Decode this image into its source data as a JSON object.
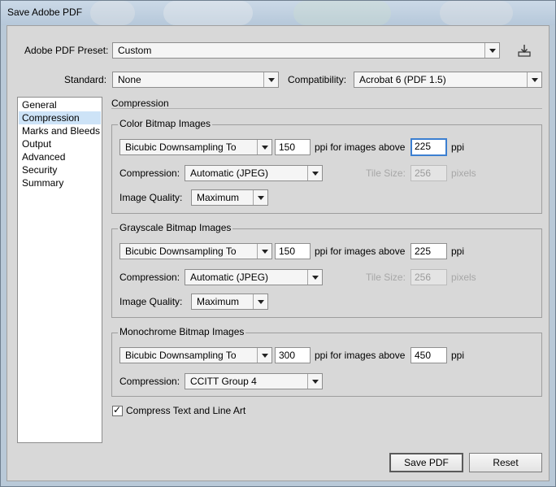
{
  "window": {
    "title": "Save Adobe PDF"
  },
  "preset": {
    "label": "Adobe PDF Preset:",
    "value": "Custom",
    "save_icon": "save-preset-icon"
  },
  "standard": {
    "label": "Standard:",
    "value": "None"
  },
  "compatibility": {
    "label": "Compatibility:",
    "value": "Acrobat 6 (PDF 1.5)"
  },
  "sidebar": {
    "items": [
      {
        "label": "General"
      },
      {
        "label": "Compression",
        "selected": true
      },
      {
        "label": "Marks and Bleeds"
      },
      {
        "label": "Output"
      },
      {
        "label": "Advanced"
      },
      {
        "label": "Security"
      },
      {
        "label": "Summary"
      }
    ]
  },
  "section": {
    "title": "Compression"
  },
  "color_group": {
    "title": "Color Bitmap Images",
    "downsampling": "Bicubic Downsampling To",
    "ppi": "150",
    "above_label": "ppi for images above",
    "above_ppi": "225",
    "ppi_unit": "ppi",
    "compression_label": "Compression:",
    "compression": "Automatic (JPEG)",
    "tile_label": "Tile Size:",
    "tile": "256",
    "tile_unit": "pixels",
    "quality_label": "Image Quality:",
    "quality": "Maximum"
  },
  "gray_group": {
    "title": "Grayscale Bitmap Images",
    "downsampling": "Bicubic Downsampling To",
    "ppi": "150",
    "above_label": "ppi for images above",
    "above_ppi": "225",
    "ppi_unit": "ppi",
    "compression_label": "Compression:",
    "compression": "Automatic (JPEG)",
    "tile_label": "Tile Size:",
    "tile": "256",
    "tile_unit": "pixels",
    "quality_label": "Image Quality:",
    "quality": "Maximum"
  },
  "mono_group": {
    "title": "Monochrome Bitmap Images",
    "downsampling": "Bicubic Downsampling To",
    "ppi": "300",
    "above_label": "ppi for images above",
    "above_ppi": "450",
    "ppi_unit": "ppi",
    "compression_label": "Compression:",
    "compression": "CCITT Group 4"
  },
  "compress_text": {
    "label": "Compress Text and Line Art",
    "checked": true
  },
  "buttons": {
    "save": "Save PDF",
    "reset": "Reset"
  },
  "colors": {
    "selection": "#cde3f7",
    "focus": "#3c7fd1"
  }
}
